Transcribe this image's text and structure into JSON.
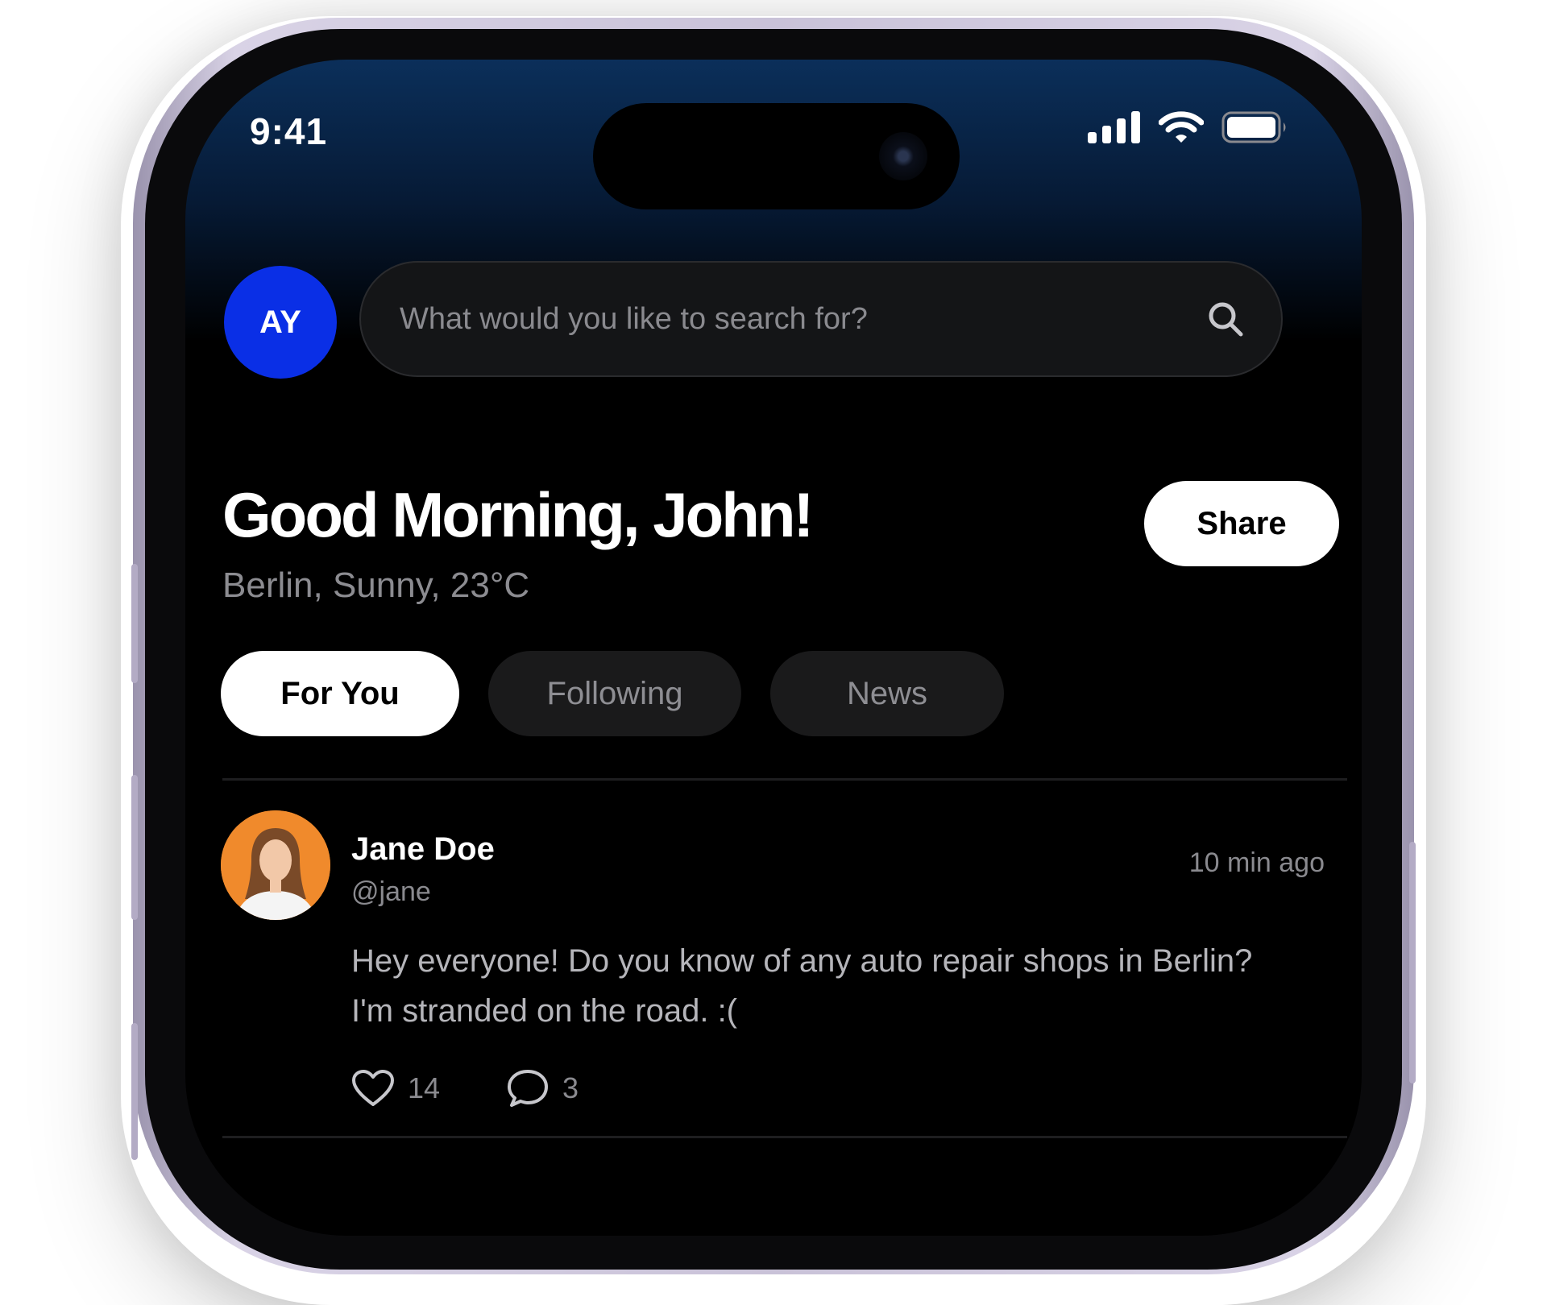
{
  "status_bar": {
    "time": "9:41"
  },
  "header": {
    "avatar_initials": "AY",
    "search_placeholder": "What would you like to search for?"
  },
  "greeting": {
    "title": "Good Morning, John!",
    "subtitle": "Berlin, Sunny, 23°C",
    "share_label": "Share"
  },
  "tabs": [
    {
      "label": "For You",
      "active": true
    },
    {
      "label": "Following",
      "active": false
    },
    {
      "label": "News",
      "active": false
    }
  ],
  "post": {
    "author": "Jane Doe",
    "handle": "@jane",
    "time": "10 min ago",
    "text_line1": "Hey everyone! Do you know of any auto repair shops in Berlin?",
    "text_line2": "I'm stranded on the road. :(",
    "likes": "14",
    "comments": "3"
  },
  "colors": {
    "accent_blue": "#0a2fe6",
    "avatar_bg": "#f08a2c",
    "screen_bg": "#000000"
  }
}
